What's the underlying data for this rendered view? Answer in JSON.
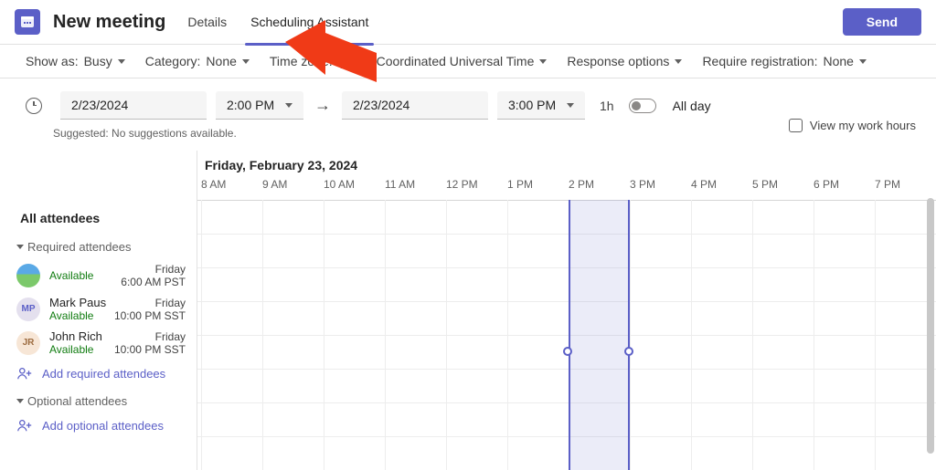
{
  "header": {
    "title": "New meeting",
    "tabs": {
      "details": "Details",
      "scheduling": "Scheduling Assistant"
    },
    "send": "Send"
  },
  "toolbar": {
    "show_as_label": "Show as:",
    "show_as_value": "Busy",
    "category_label": "Category:",
    "category_value": "None",
    "timezone_label": "Time zone:",
    "timezone_value": "(UTC) Coordinated Universal Time",
    "response_options": "Response options",
    "registration_label": "Require registration:",
    "registration_value": "None"
  },
  "datetime": {
    "start_date": "2/23/2024",
    "start_time": "2:00 PM",
    "end_date": "2/23/2024",
    "end_time": "3:00 PM",
    "duration": "1h",
    "all_day": "All day"
  },
  "suggested": "Suggested: No suggestions available.",
  "work_hours_label": "View my work hours",
  "sidebar": {
    "all_attendees": "All attendees",
    "required_heading": "Required attendees",
    "optional_heading": "Optional attendees",
    "add_required": "Add required attendees",
    "add_optional": "Add optional attendees",
    "attendees": [
      {
        "name": "",
        "status": "Available",
        "day": "Friday",
        "time": "6:00 AM PST",
        "initials": ""
      },
      {
        "name": "Mark Paus",
        "status": "Available",
        "day": "Friday",
        "time": "10:00 PM SST",
        "initials": "MP"
      },
      {
        "name": "John Rich",
        "status": "Available",
        "day": "Friday",
        "time": "10:00 PM SST",
        "initials": "JR"
      }
    ]
  },
  "grid": {
    "date_label": "Friday, February 23, 2024",
    "hours": [
      "8 AM",
      "9 AM",
      "10 AM",
      "11 AM",
      "12 PM",
      "1 PM",
      "2 PM",
      "3 PM",
      "4 PM",
      "5 PM",
      "6 PM",
      "7 PM"
    ]
  }
}
